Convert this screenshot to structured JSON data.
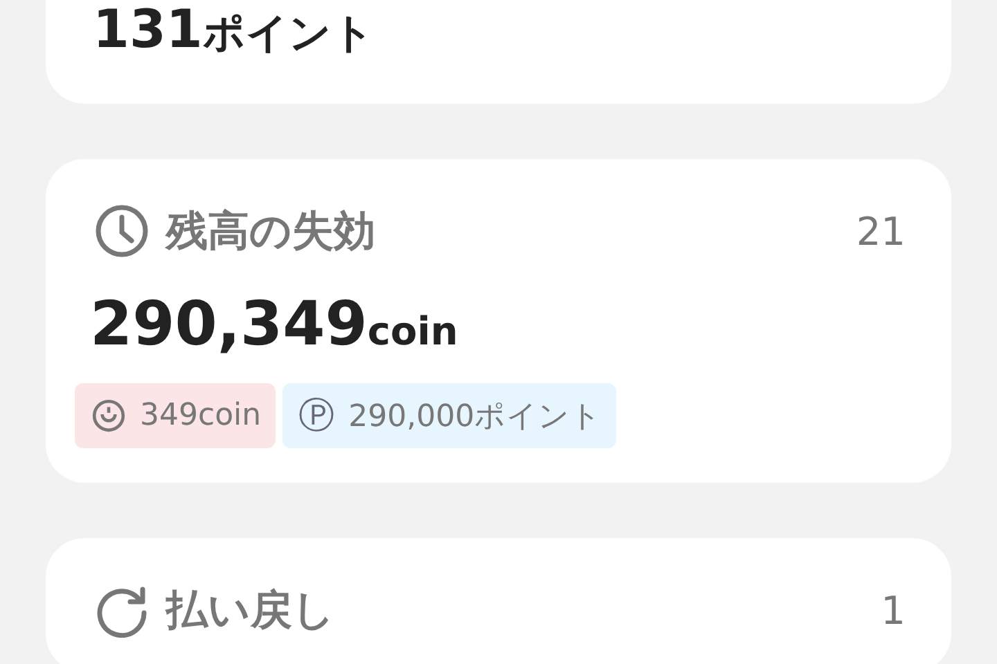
{
  "top_card": {
    "amount": "131",
    "unit": "ポイント"
  },
  "cards": [
    {
      "kind": "clock",
      "title": "残高の失効",
      "count": "21",
      "amount": "290,349",
      "unit": "coin",
      "tags": [
        {
          "kind": "coin",
          "text": "349coin",
          "color": "#fbe5e6"
        },
        {
          "kind": "point",
          "symbol": "Ⓟ",
          "text": "290,000ポイント",
          "color": "#e6f5fe"
        }
      ]
    },
    {
      "kind": "refresh",
      "title": "払い戻し",
      "count": "1"
    }
  ]
}
